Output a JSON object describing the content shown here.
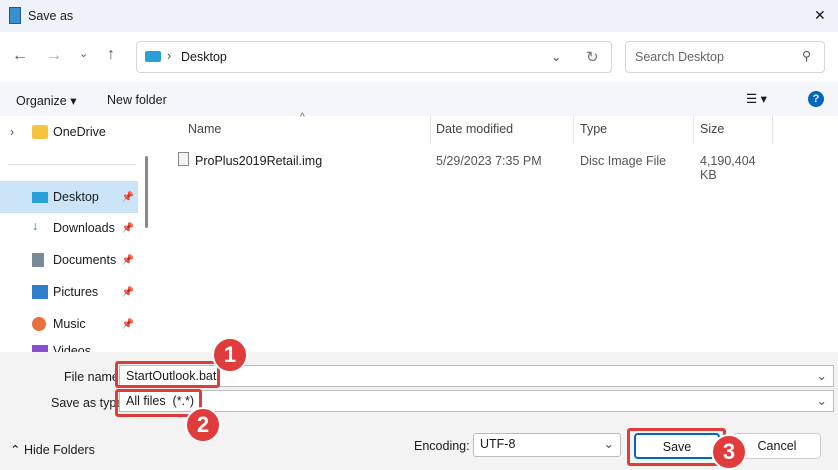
{
  "window": {
    "title": "Save as",
    "close_icon": "✕"
  },
  "nav": {
    "path": "Desktop",
    "search_placeholder": "Search Desktop"
  },
  "toolbar": {
    "organize": "Organize",
    "new_folder": "New folder"
  },
  "sidebar": {
    "items": [
      {
        "label": "OneDrive",
        "icon": "folder-icon"
      },
      {
        "label": "Desktop",
        "icon": "desktop-icon",
        "selected": true
      },
      {
        "label": "Downloads",
        "icon": "download-icon"
      },
      {
        "label": "Documents",
        "icon": "documents-icon"
      },
      {
        "label": "Pictures",
        "icon": "pictures-icon"
      },
      {
        "label": "Music",
        "icon": "music-icon"
      },
      {
        "label": "Videos",
        "icon": "videos-icon"
      }
    ]
  },
  "columns": [
    "Name",
    "Date modified",
    "Type",
    "Size"
  ],
  "files": [
    {
      "name": "ProPlus2019Retail.img",
      "date": "5/29/2023 7:35 PM",
      "type": "Disc Image File",
      "size": "4,190,404 KB"
    }
  ],
  "form": {
    "file_name_label": "File name:",
    "file_name": "StartOutlook.bat",
    "type_label": "Save as type:",
    "type": "All files  (*.*)",
    "encoding_label": "Encoding:",
    "encoding": "UTF-8"
  },
  "buttons": {
    "hide_folders": "Hide Folders",
    "save": "Save",
    "cancel": "Cancel"
  },
  "annotations": [
    "1",
    "2",
    "3"
  ],
  "colors": {
    "accent": "#0067c0",
    "annotation": "#e03c3c",
    "selected": "#cce4f7"
  }
}
